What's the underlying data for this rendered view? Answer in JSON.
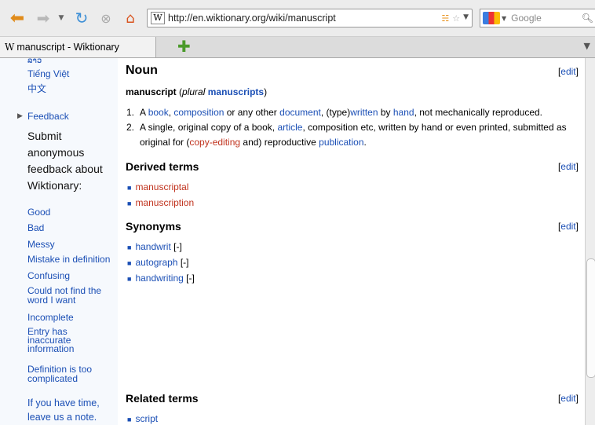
{
  "browser": {
    "url": "http://en.wiktionary.org/wiki/manuscript",
    "search_placeholder": "Google",
    "tab_title": "manuscript - Wiktionary",
    "favicon_letter": "W"
  },
  "sidebar": {
    "languages": [
      "ລາວ",
      "Tiếng Việt",
      "中文"
    ],
    "feedback_label": "Feedback",
    "prompt_lines": [
      "Submit",
      "anonymous",
      "feedback about",
      "Wiktionary:"
    ],
    "options": [
      "Good",
      "Bad",
      "Messy",
      "Mistake in definition",
      "Confusing",
      "Could not find the word I want",
      "Incomplete",
      "Entry has inaccurate information",
      "Definition is too complicated"
    ],
    "note": "If you have time, leave us a note."
  },
  "content": {
    "edit_label": "edit",
    "noun_heading": "Noun",
    "headword": "manuscript",
    "plural_label": "plural",
    "plural_form": "manuscripts",
    "definitions": [
      {
        "parts": [
          {
            "t": "A ",
            "c": ""
          },
          {
            "t": "book",
            "c": "link"
          },
          {
            "t": ", ",
            "c": ""
          },
          {
            "t": "composition",
            "c": "link"
          },
          {
            "t": " or any other ",
            "c": ""
          },
          {
            "t": "document",
            "c": "link"
          },
          {
            "t": ", (type)",
            "c": ""
          },
          {
            "t": "written",
            "c": "link"
          },
          {
            "t": " by ",
            "c": ""
          },
          {
            "t": "hand",
            "c": "link"
          },
          {
            "t": ", not mechanically reproduced.",
            "c": ""
          }
        ]
      },
      {
        "parts": [
          {
            "t": "A single, original copy of a book, ",
            "c": ""
          },
          {
            "t": "article",
            "c": "link"
          },
          {
            "t": ", composition etc, written by hand or even printed, submitted as original for (",
            "c": ""
          },
          {
            "t": "copy-editing",
            "c": "red"
          },
          {
            "t": " and) reproductive ",
            "c": ""
          },
          {
            "t": "publication",
            "c": "link"
          },
          {
            "t": ".",
            "c": ""
          }
        ]
      }
    ],
    "derived_heading": "Derived terms",
    "derived_terms": [
      "manuscriptal",
      "manuscription"
    ],
    "synonyms_heading": "Synonyms",
    "synonyms": [
      "handwrit",
      "autograph",
      "handwriting"
    ],
    "synonym_suffix": "[-]",
    "related_heading": "Related terms",
    "related_terms": [
      "script"
    ]
  },
  "colors": {
    "link": "#1b4fb5",
    "redlink": "#c0321d",
    "sidebar_bg": "#f6f9fd"
  },
  "icons": [
    "back-arrow-icon",
    "forward-arrow-icon",
    "reload-icon",
    "stop-icon",
    "home-icon",
    "rss-icon",
    "star-icon",
    "search-magnifier-icon",
    "new-tab-plus-icon"
  ]
}
